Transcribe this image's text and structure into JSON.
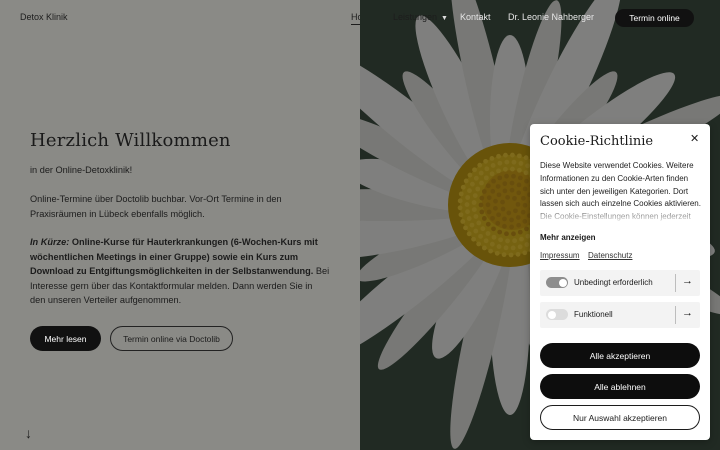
{
  "header": {
    "logo": "Detox Klinik",
    "nav": {
      "home": "Home",
      "leistungen": "Leistungen",
      "kontakt": "Kontakt",
      "doctor": "Dr. Leonie Nahberger"
    },
    "cta": "Termin online"
  },
  "hero": {
    "title": "Herzlich Willkommen",
    "subtitle": "in der Online-Detoxklinik!",
    "paragraph1": "Online-Termine über Doctolib buchbar. Vor-Ort Termine in den Praxisräumen in Lübeck ebenfalls möglich.",
    "paragraph2_intro": "In Kürze:",
    "paragraph2_bold": " Online-Kurse für Hauterkrankungen (6-Wochen-Kurs mit wöchentlichen Meetings in einer Gruppe) sowie ein Kurs zum Download zu Entgiftungsmöglichkeiten in der Selbstanwendung.",
    "paragraph2_rest": " Bei Interesse gern über das Kontaktformular melden. Dann werden Sie in den unseren Verteiler aufgenommen.",
    "more_button": "Mehr lesen",
    "doctolib_button": "Termin online via Doctolib",
    "scroll_icon": "arrow-down-icon"
  },
  "cookie": {
    "title": "Cookie-Richtlinie",
    "close_icon": "close-icon",
    "body": "Diese Website verwendet Cookies. Weitere Informationen zu den Cookie-Arten finden sich unter den jeweiligen Kategorien. Dort lassen sich auch einzelne Cookies aktivieren. Die Cookie-Einstellungen können jederzeit",
    "show_more": "Mehr anzeigen",
    "links": {
      "impressum": "Impressum",
      "datenschutz": "Datenschutz"
    },
    "categories": [
      {
        "label": "Unbedingt erforderlich",
        "enabled": true
      },
      {
        "label": "Funktionell",
        "enabled": false
      }
    ],
    "accept_all": "Alle akzeptieren",
    "reject_all": "Alle ablehnen",
    "accept_selection": "Nur Auswahl akzeptieren"
  },
  "colors": {
    "button_dark": "#111111",
    "overlay_gray": "#8a8a86",
    "flower_center": "#e2b91f"
  }
}
